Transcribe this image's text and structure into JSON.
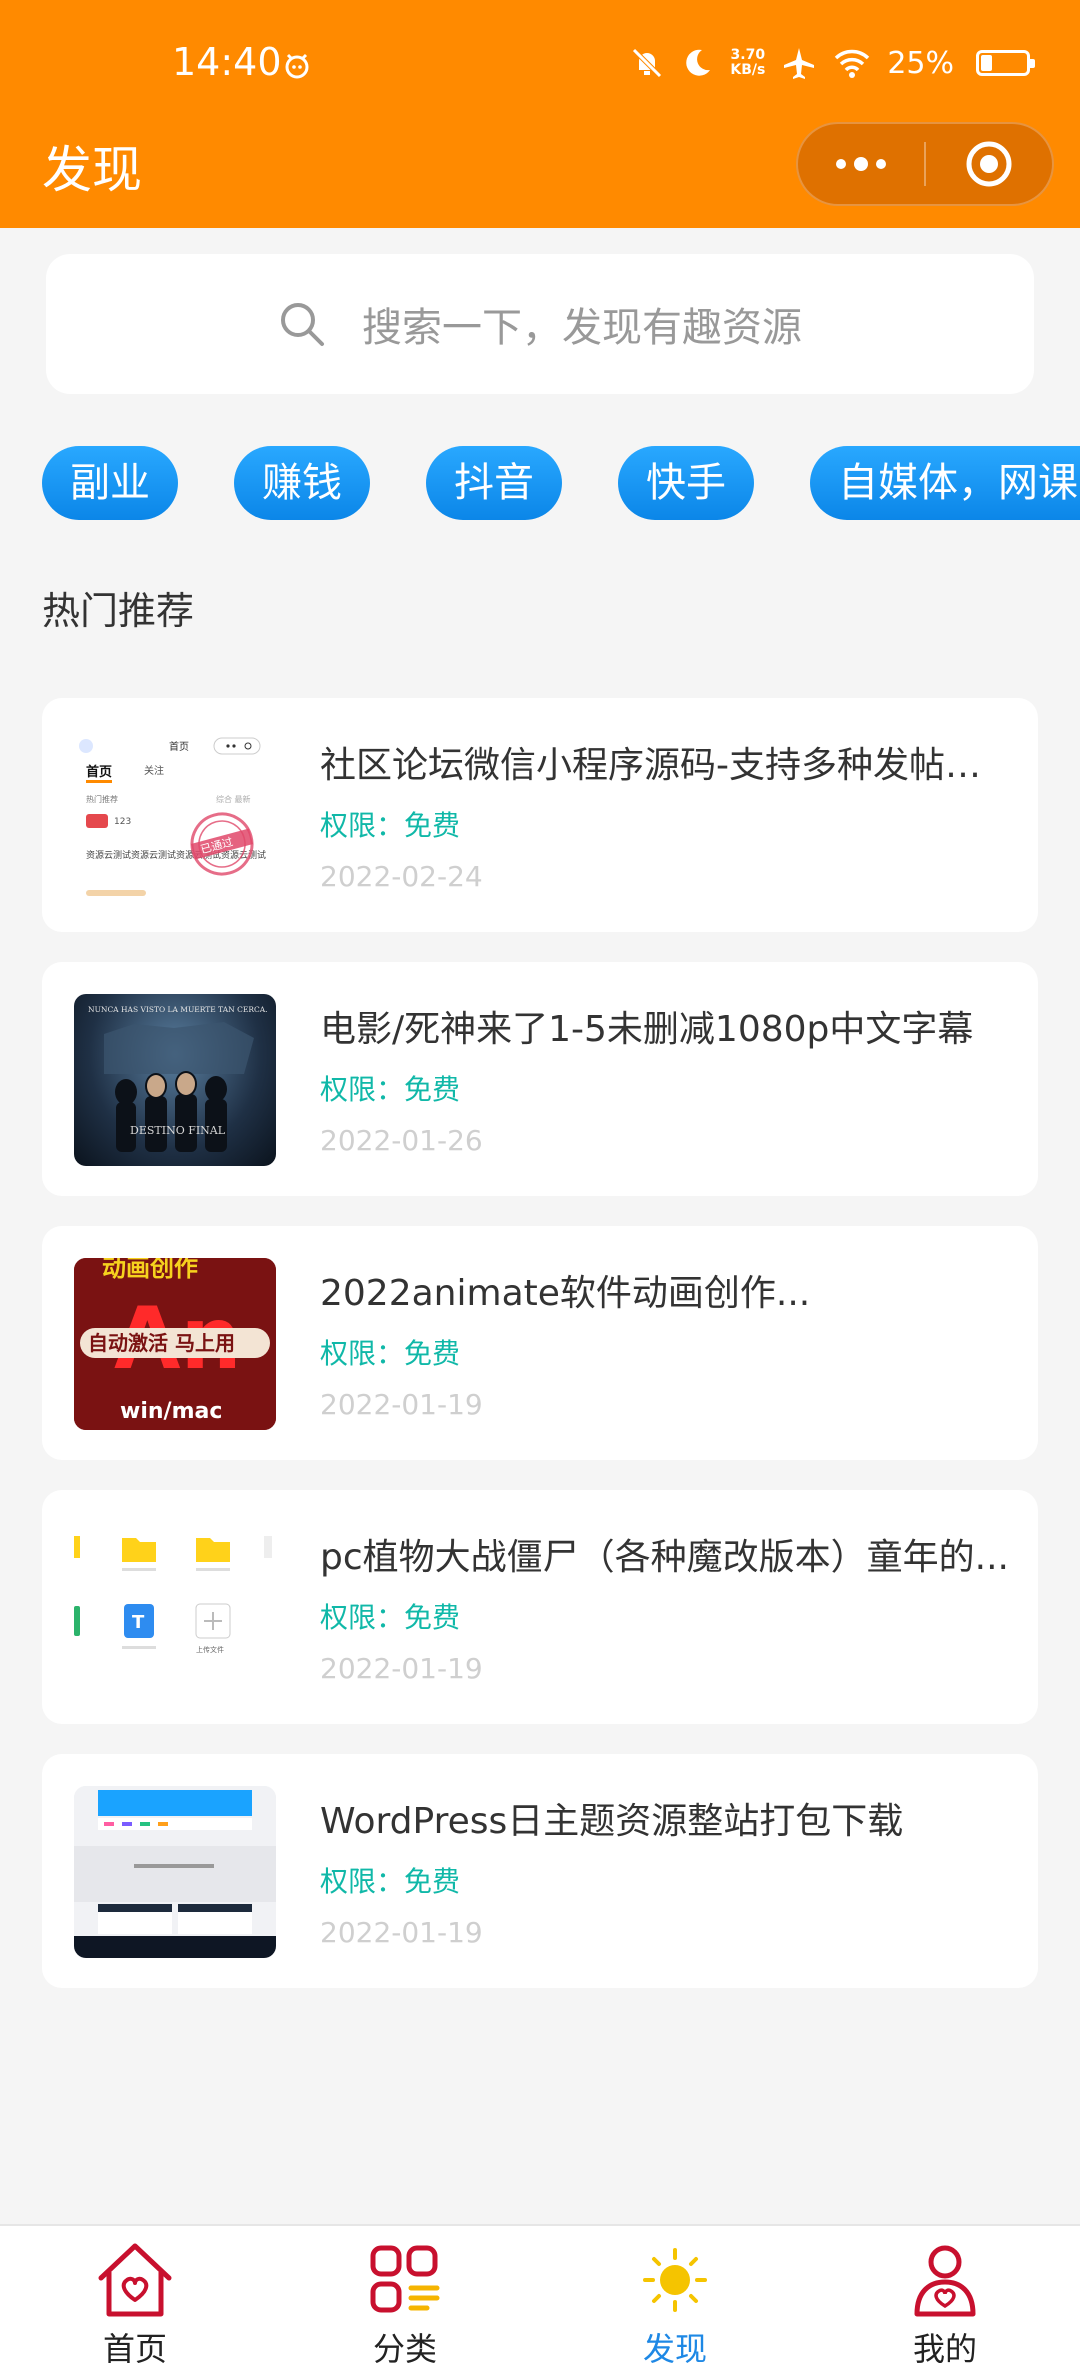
{
  "status_bar": {
    "time": "14:40",
    "net_speed_value": "3.70",
    "net_speed_unit": "KB/s",
    "battery": "25%"
  },
  "nav": {
    "title": "发现"
  },
  "search": {
    "placeholder": "搜索一下，发现有趣资源"
  },
  "tags": [
    "副业",
    "赚钱",
    "抖音",
    "快手",
    "自媒体，网课，"
  ],
  "section": {
    "title": "热门推荐"
  },
  "items": [
    {
      "title": "社区论坛微信小程序源码-支持多种发帖模...",
      "perm_label": "权限：",
      "perm_value": "免费",
      "date": "2022-02-24",
      "thumb": {
        "nav_title": "首页",
        "tab_home": "首页",
        "tab_follow": "关注",
        "hot": "热门推荐",
        "sub": "综合 最新",
        "user": "123",
        "post": "资源云测试资源云测试资源云测试资源云测试",
        "stamp": "已通过"
      }
    },
    {
      "title": "电影/死神来了1-5未删减1080p中文字幕",
      "perm_label": "权限：",
      "perm_value": "免费",
      "date": "2022-01-26",
      "thumb": {
        "tagline": "NUNCA HAS VISTO LA MUERTE TAN CERCA.",
        "caption": "DESTINO FINAL"
      }
    },
    {
      "title": "2022animate软件动画创作...",
      "perm_label": "权限：",
      "perm_value": "免费",
      "date": "2022-01-19",
      "thumb": {
        "top": "动画创作",
        "big": "An",
        "banner": "自动激活 马上用",
        "bottom": "win/mac"
      }
    },
    {
      "title": "pc植物大战僵尸（各种魔改版本）童年的...",
      "perm_label": "权限：",
      "perm_value": "免费",
      "date": "2022-01-19",
      "thumb": {
        "f1": "",
        "f2": "上传文件"
      }
    },
    {
      "title": "WordPress日主题资源整站打包下载",
      "perm_label": "权限：",
      "perm_value": "免费",
      "date": "2022-01-19",
      "thumb": {}
    }
  ],
  "tabbar": [
    {
      "label": "首页",
      "icon": "house-heart-icon"
    },
    {
      "label": "分类",
      "icon": "grid-list-icon"
    },
    {
      "label": "发现",
      "icon": "sun-icon",
      "active": true
    },
    {
      "label": "我的",
      "icon": "person-heart-icon"
    }
  ],
  "colors": {
    "header": "#ff8a00",
    "tag": "#1e90f0",
    "perm": "#10b8a8",
    "active_tab": "#1e88e5",
    "icon_red": "#c8102e"
  }
}
